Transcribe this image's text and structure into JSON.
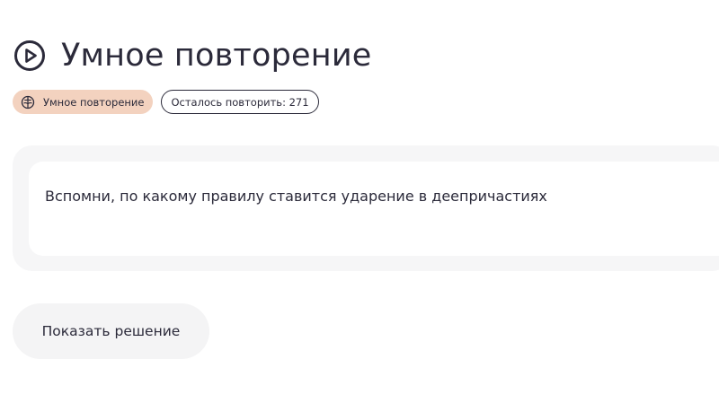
{
  "header": {
    "icon": "play-circle-icon",
    "title": "Умное повторение"
  },
  "badges": {
    "mode": {
      "icon": "brain-icon",
      "label": "Умное повторение",
      "color": "#f3d2bf"
    },
    "remaining": {
      "label": "Осталось повторить: 271"
    }
  },
  "card": {
    "question": "Вспомни, по какому правилу ставится ударение в деепричастиях"
  },
  "actions": {
    "show_solution_label": "Показать решение"
  },
  "colors": {
    "text": "#2b2a3a",
    "card_bg": "#f6f6f7",
    "button_bg": "#f4f4f5",
    "accent": "#f3d2bf"
  }
}
